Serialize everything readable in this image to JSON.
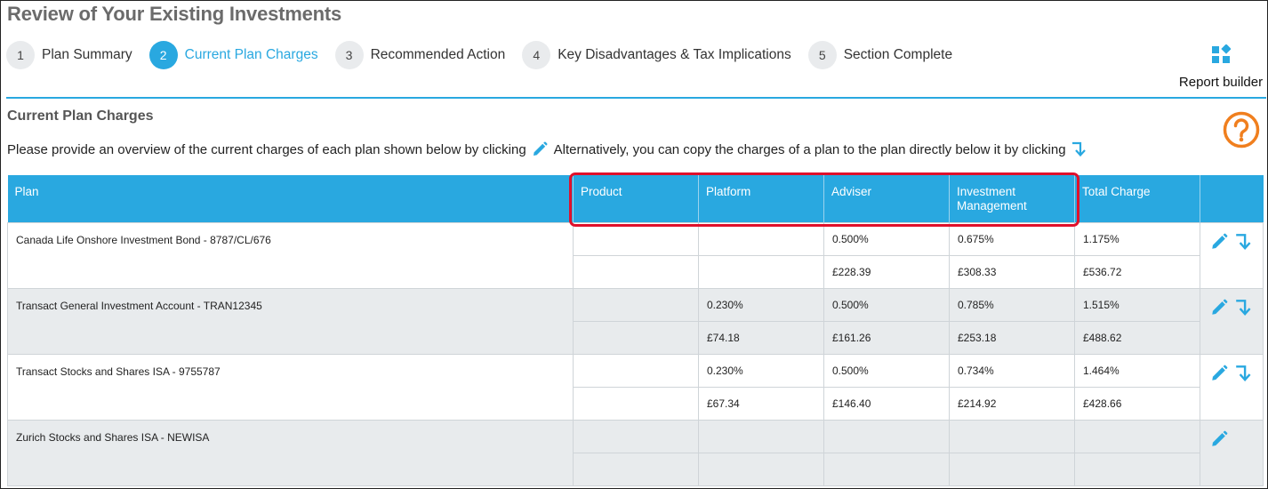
{
  "page": {
    "title": "Review of Your Existing Investments"
  },
  "steps": [
    {
      "number": "1",
      "label": "Plan Summary",
      "active": false
    },
    {
      "number": "2",
      "label": "Current Plan Charges",
      "active": true
    },
    {
      "number": "3",
      "label": "Recommended Action",
      "active": false
    },
    {
      "number": "4",
      "label": "Key Disadvantages & Tax Implications",
      "active": false
    },
    {
      "number": "5",
      "label": "Section Complete",
      "active": false
    }
  ],
  "report_builder": {
    "label": "Report builder",
    "icon": "report-builder-icon"
  },
  "section": {
    "title": "Current Plan Charges",
    "instruction_part1": "Please provide an overview of the current charges of each plan shown below by clicking",
    "instruction_part2": "Alternatively, you can copy the charges of a plan to the plan directly below it by clicking"
  },
  "table": {
    "headers": [
      "Plan",
      "Product",
      "Platform",
      "Adviser",
      "Investment Management",
      "Total Charge",
      ""
    ],
    "rows": [
      {
        "plan": "Canada Life Onshore Investment Bond - 8787/CL/676",
        "percent": [
          "",
          "",
          "0.500%",
          "0.675%",
          "1.175%"
        ],
        "amount": [
          "",
          "",
          "£228.39",
          "£308.33",
          "£536.72"
        ],
        "has_copy": true
      },
      {
        "plan": "Transact General Investment Account - TRAN12345",
        "percent": [
          "",
          "0.230%",
          "0.500%",
          "0.785%",
          "1.515%"
        ],
        "amount": [
          "",
          "£74.18",
          "£161.26",
          "£253.18",
          "£488.62"
        ],
        "has_copy": true
      },
      {
        "plan": "Transact Stocks and Shares ISA - 9755787",
        "percent": [
          "",
          "0.230%",
          "0.500%",
          "0.734%",
          "1.464%"
        ],
        "amount": [
          "",
          "£67.34",
          "£146.40",
          "£214.92",
          "£428.66"
        ],
        "has_copy": true
      },
      {
        "plan": "Zurich Stocks and Shares ISA - NEWISA",
        "percent": [
          "",
          "",
          "",
          "",
          ""
        ],
        "amount": [
          "",
          "",
          "",
          "",
          ""
        ],
        "has_copy": false
      }
    ]
  },
  "colors": {
    "accent": "#29a8e0",
    "help": "#f07f1e",
    "highlight": "#e0102b",
    "row_shade": "#e8ebed"
  }
}
